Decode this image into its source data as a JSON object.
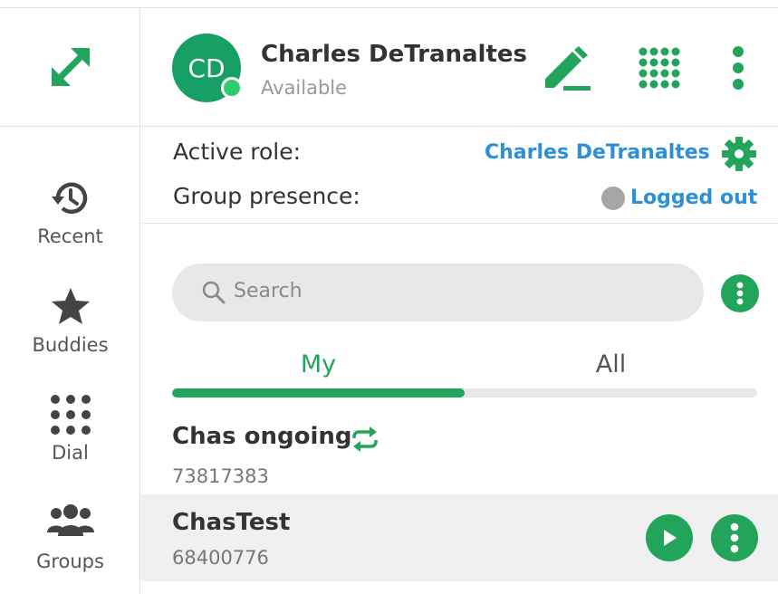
{
  "profile": {
    "initials": "CD",
    "name": "Charles DeTranaltes",
    "status": "Available"
  },
  "nav": {
    "recent": "Recent",
    "buddies": "Buddies",
    "dial": "Dial",
    "groups": "Groups"
  },
  "roles": {
    "active_role_label": "Active role:",
    "active_role_value": "Charles DeTranaltes",
    "group_presence_label": "Group presence:",
    "group_presence_value": "Logged out"
  },
  "search": {
    "placeholder": "Search"
  },
  "tabs": [
    {
      "label": "My",
      "active": true
    },
    {
      "label": "All",
      "active": false
    }
  ],
  "tab_progress": 0.5,
  "items": [
    {
      "name": "Chas ongoing",
      "number": "73817383",
      "recurring": true
    },
    {
      "name": "ChasTest",
      "number": "68400776",
      "selected": true
    }
  ],
  "colors": {
    "accent": "#22a55a",
    "link": "#2d8fd6",
    "avatar": "#16a063",
    "online": "#2ecc71",
    "offline": "#a6a6a6"
  },
  "icons": [
    "expand-icon",
    "history-icon",
    "star-icon",
    "dialpad-icon",
    "groups-icon",
    "pencil-icon",
    "grid-icon",
    "more-vertical-icon",
    "gear-icon",
    "search-icon",
    "sync-icon",
    "play-icon"
  ]
}
